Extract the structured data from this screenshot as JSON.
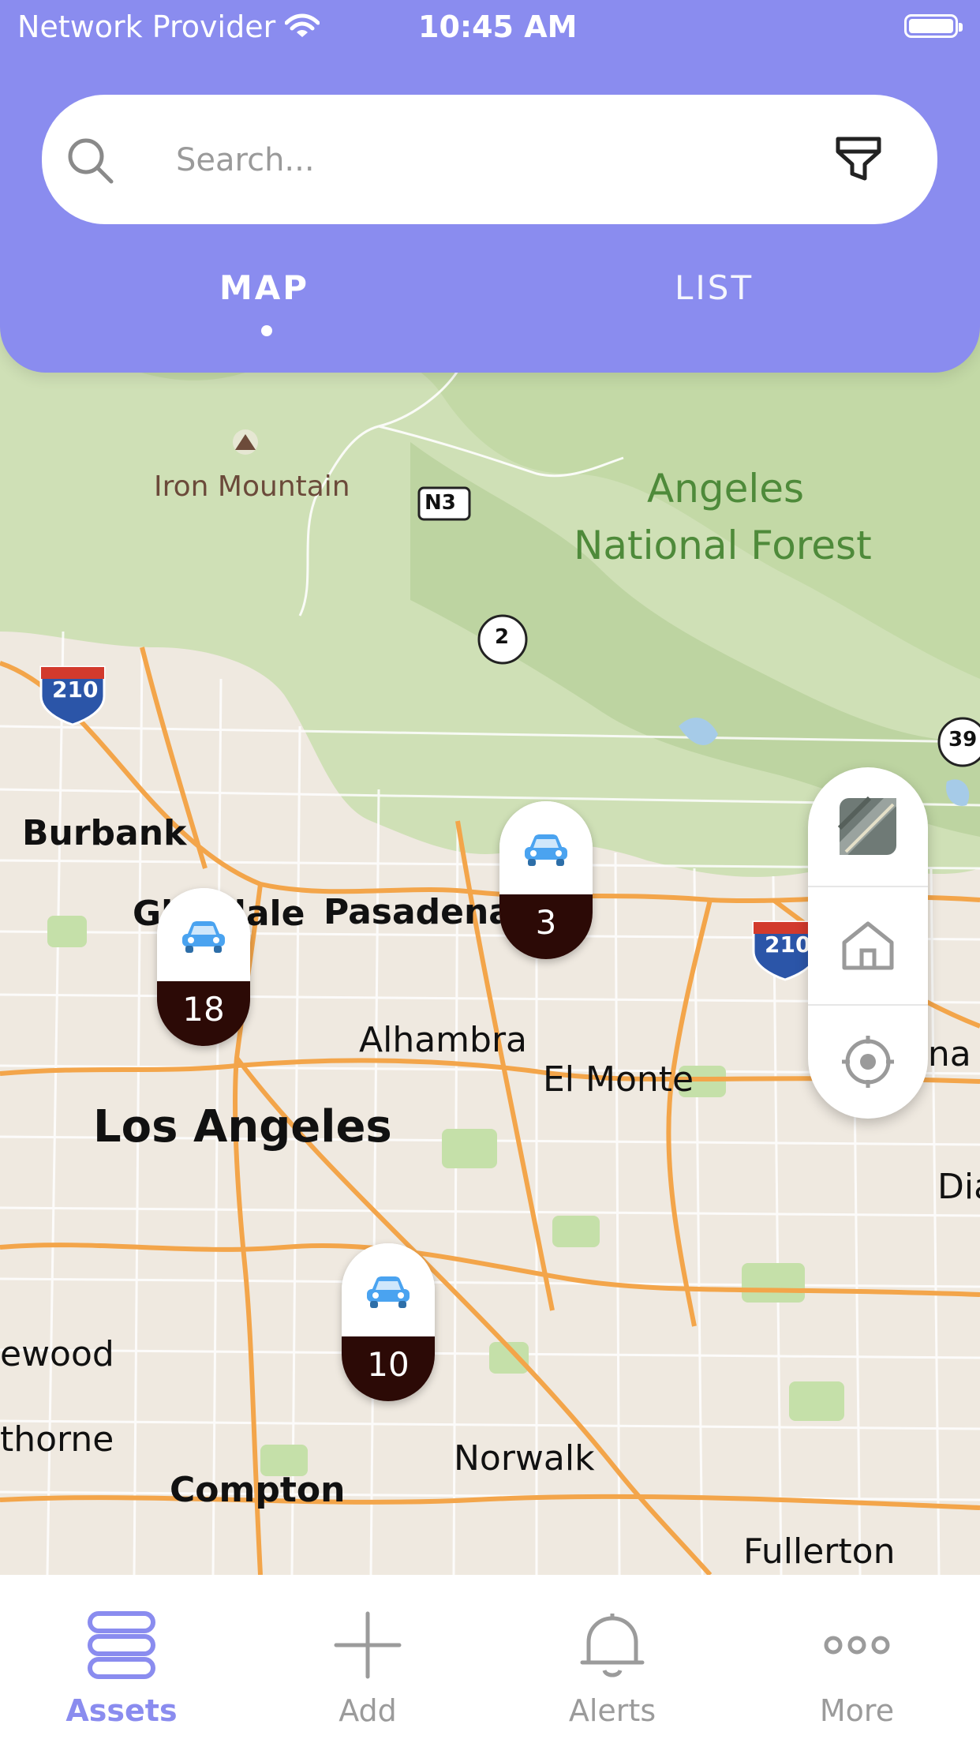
{
  "status_bar": {
    "carrier": "Network Provider",
    "time": "10:45 AM"
  },
  "search": {
    "placeholder": "Search..."
  },
  "tabs": [
    {
      "label": "MAP",
      "active": true
    },
    {
      "label": "LIST",
      "active": false
    }
  ],
  "map": {
    "labels": {
      "iron_mountain": "Iron Mountain",
      "forest_1": "Angeles",
      "forest_2": "National Forest",
      "burbank": "Burbank",
      "glendale": "Glendale",
      "pasadena": "Pasadena",
      "alhambra": "Alhambra",
      "el_monte": "El Monte",
      "los_angeles": "Los Angeles",
      "covina": "Covina",
      "diamond": "Dia",
      "inglewood": "ewood",
      "hawthorne": "thorne",
      "compton": "Compton",
      "norwalk": "Norwalk",
      "fullerton": "Fullerton"
    },
    "road_shields": {
      "n3": "N3",
      "route_2": "2",
      "route_39": "39",
      "i210_west": "210",
      "i210_east": "210"
    },
    "clusters": [
      {
        "count": "18"
      },
      {
        "count": "3"
      },
      {
        "count": "10"
      }
    ]
  },
  "bottom_nav": [
    {
      "label": "Assets",
      "icon": "stack-icon",
      "active": true
    },
    {
      "label": "Add",
      "icon": "plus-icon",
      "active": false
    },
    {
      "label": "Alerts",
      "icon": "bell-icon",
      "active": false
    },
    {
      "label": "More",
      "icon": "more-icon",
      "active": false
    }
  ],
  "colors": {
    "accent": "#8a8cef",
    "marker_bottom": "#2c0a06",
    "forest_green": "#4e8a3a"
  }
}
